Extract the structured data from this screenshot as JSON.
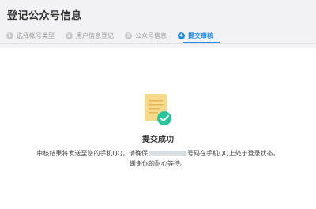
{
  "page": {
    "title": "登记公众号信息"
  },
  "steps": [
    {
      "num": "1",
      "label": "选择帐号类型"
    },
    {
      "num": "2",
      "label": "用户信息登记"
    },
    {
      "num": "3",
      "label": "公众号信息"
    },
    {
      "num": "4",
      "label": "提交审核",
      "active": true
    }
  ],
  "result": {
    "title": "提交成功",
    "message_part1": "审核结果将发送至您的手机QQ，请确保",
    "message_part2": "号码在手机QQ上处于登录状态。",
    "message_line2": "谢谢你的耐心等待。"
  },
  "colors": {
    "accent": "#1f8ef1",
    "success": "#28c59b",
    "doc": "#f7d98b"
  },
  "icons": {
    "result": "document-check-icon"
  }
}
